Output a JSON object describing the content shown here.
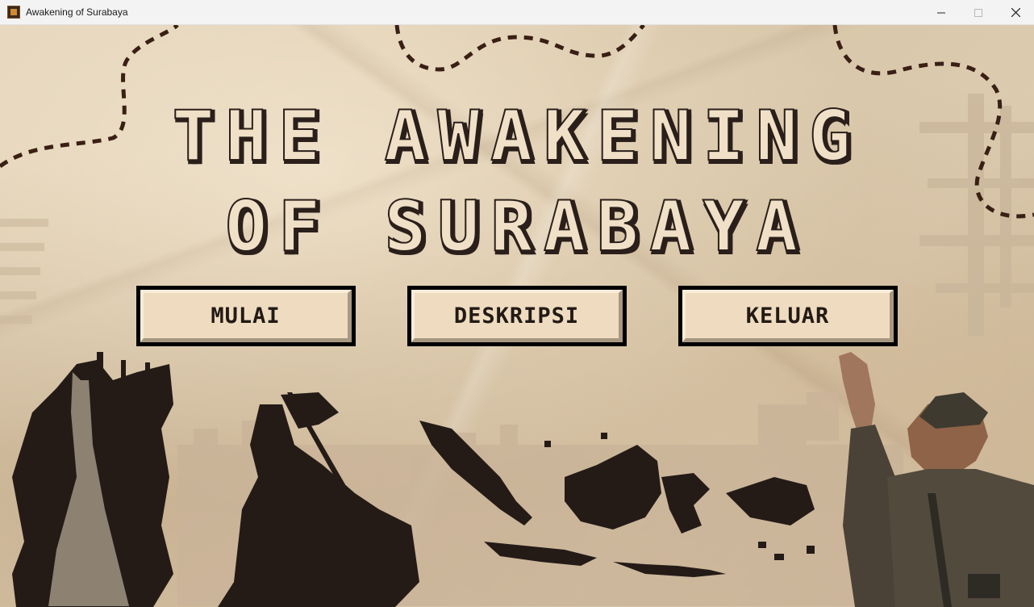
{
  "window": {
    "title": "Awakening of Surabaya",
    "icon": "game-app-icon"
  },
  "game": {
    "title_line1": "THE AWAKENING",
    "title_line2": "OF SURABAYA",
    "buttons": {
      "start": "MULAI",
      "description": "DESKRIPSI",
      "exit": "KELUAR"
    },
    "colors": {
      "paper": "#d9c9b0",
      "title_fill": "#efe0c7",
      "outline": "#2a1f1a",
      "button_face": "#efdcc0",
      "silhouette": "#241b17",
      "dashed_path": "#3a1f14"
    },
    "illustrations": [
      "monument-silhouette",
      "flag-raising-silhouette",
      "indonesia-map-silhouette",
      "soldier-pointing-figure"
    ]
  }
}
